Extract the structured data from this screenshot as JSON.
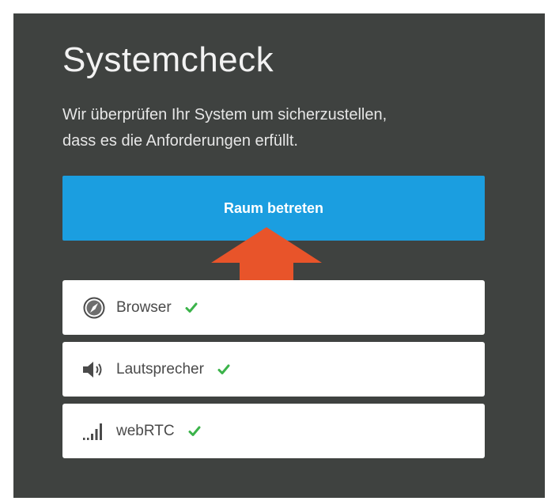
{
  "page": {
    "title": "Systemcheck",
    "description_lines": [
      "Wir überprüfen Ihr System um sicherzustellen,",
      "dass es die Anforderungen erfüllt."
    ],
    "primary_button": "Raum betreten"
  },
  "checks": [
    {
      "label": "Browser",
      "icon": "compass-icon",
      "status": "ok"
    },
    {
      "label": "Lautsprecher",
      "icon": "speaker-icon",
      "status": "ok"
    },
    {
      "label": "webRTC",
      "icon": "signal-bars-icon",
      "status": "ok"
    }
  ],
  "colors": {
    "panel_background": "#3f4240",
    "primary_button": "#1b9ee0",
    "arrow": "#e8542a",
    "check_ok": "#3bb34a"
  }
}
